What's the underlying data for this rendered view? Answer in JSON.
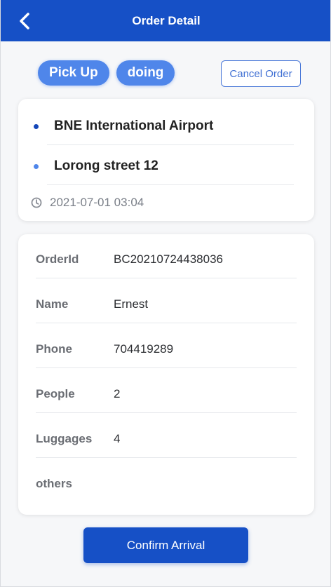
{
  "header": {
    "title": "Order Detail",
    "back_icon": "chevron-left-icon"
  },
  "status": {
    "chips": [
      "Pick Up",
      "doing"
    ],
    "cancel_label": "Cancel Order"
  },
  "route": {
    "pickup": "BNE International Airport",
    "dropoff": "Lorong street 12",
    "datetime": "2021-07-01 03:04",
    "pickup_dot_color": "#1446b8",
    "dropoff_dot_color": "#4f86ea",
    "time_icon": "clock-icon"
  },
  "order_info": {
    "rows": [
      {
        "label": "OrderId",
        "value": "BC20210724438036"
      },
      {
        "label": "Name",
        "value": "Ernest"
      },
      {
        "label": "Phone",
        "value": "704419289"
      },
      {
        "label": "People",
        "value": "2"
      },
      {
        "label": "Luggages",
        "value": "4"
      },
      {
        "label": "others",
        "value": ""
      }
    ]
  },
  "actions": {
    "confirm_label": "Confirm Arrival"
  },
  "colors": {
    "primary": "#1650c6",
    "chip": "#4f86ea"
  }
}
